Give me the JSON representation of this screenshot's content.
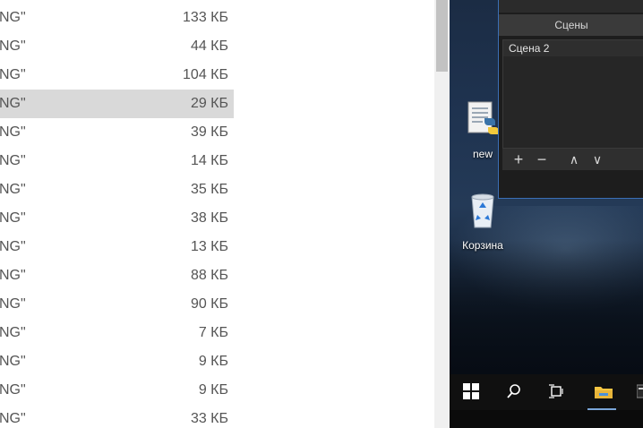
{
  "file_list": {
    "rows": [
      {
        "name": "NG\"",
        "size": "133 КБ",
        "selected": false
      },
      {
        "name": "NG\"",
        "size": "44 КБ",
        "selected": false
      },
      {
        "name": "NG\"",
        "size": "104 КБ",
        "selected": false
      },
      {
        "name": "NG\"",
        "size": "29 КБ",
        "selected": true
      },
      {
        "name": "NG\"",
        "size": "39 КБ",
        "selected": false
      },
      {
        "name": "NG\"",
        "size": "14 КБ",
        "selected": false
      },
      {
        "name": "NG\"",
        "size": "35 КБ",
        "selected": false
      },
      {
        "name": "NG\"",
        "size": "38 КБ",
        "selected": false
      },
      {
        "name": "NG\"",
        "size": "13 КБ",
        "selected": false
      },
      {
        "name": "NG\"",
        "size": "88 КБ",
        "selected": false
      },
      {
        "name": "NG\"",
        "size": "90 КБ",
        "selected": false
      },
      {
        "name": "NG\"",
        "size": "7 КБ",
        "selected": false
      },
      {
        "name": "NG\"",
        "size": "9 КБ",
        "selected": false
      },
      {
        "name": "NG\"",
        "size": "9 КБ",
        "selected": false
      },
      {
        "name": "NG\"",
        "size": "33 КБ",
        "selected": false
      }
    ]
  },
  "desktop": {
    "icons": {
      "python_file": {
        "label": "new",
        "icon": "python-file-icon"
      },
      "recycle_bin": {
        "label": "Корзина",
        "icon": "recycle-bin-icon"
      }
    }
  },
  "obs": {
    "panel_title": "Сцены",
    "scenes": [
      {
        "label": "Сцена 2"
      }
    ],
    "toolbar": {
      "add": "+",
      "remove": "−",
      "up": "∧",
      "down": "∨"
    }
  },
  "taskbar": {
    "buttons": [
      "windows-start-icon",
      "search-icon",
      "task-view-icon",
      "file-explorer-icon",
      "terminal-icon"
    ]
  },
  "colors": {
    "accent": "#3b6fb6",
    "selection": "#d9d9d9",
    "taskbar_active": "#7aa6d9"
  }
}
